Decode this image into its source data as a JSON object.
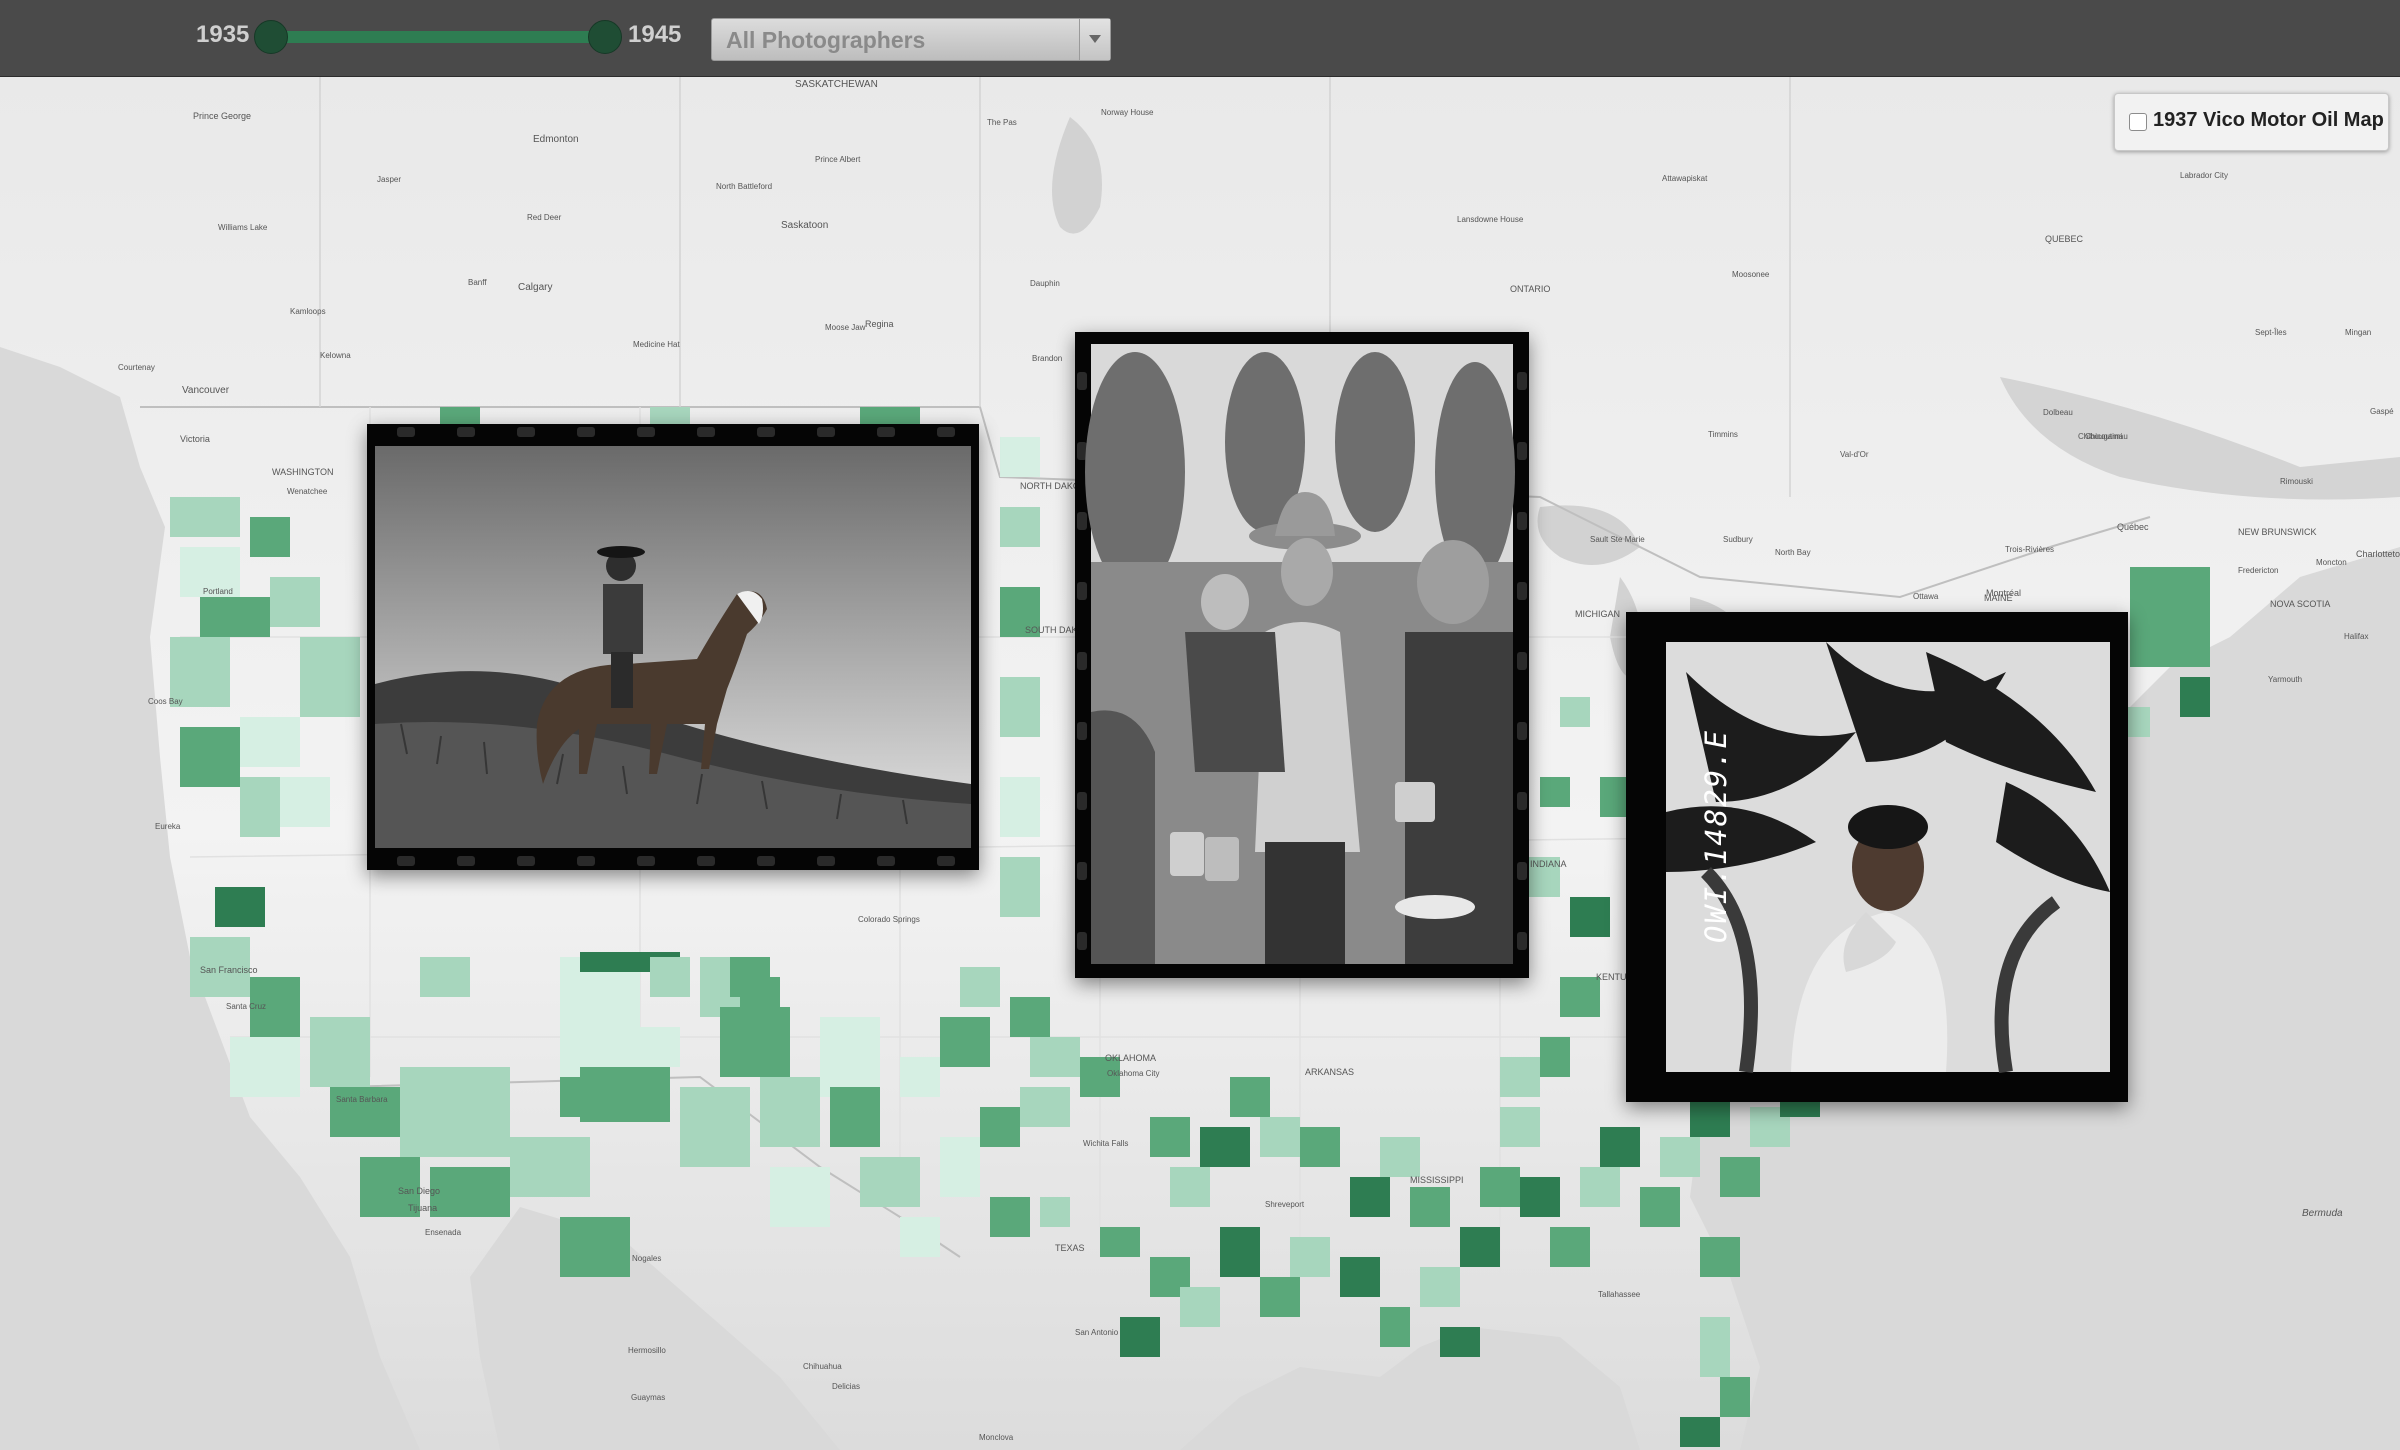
{
  "header": {
    "year_range": {
      "start_label": "1935",
      "end_label": "1945",
      "start_value": 1935,
      "end_value": 1945
    },
    "photographer_filter": {
      "selected": "All Photographers"
    }
  },
  "map_overlay": {
    "label": "1937 Vico Motor Oil Map",
    "checked": false
  },
  "colors": {
    "county_dark": "#2e7d52",
    "county_mid": "#5aa87a",
    "county_light": "#a7d6bd",
    "county_pale": "#d6efe3",
    "slider": "#2e7d52"
  },
  "map": {
    "region_labels": [
      "SASKATCHEWAN",
      "ONTARIO",
      "QUEBEC",
      "NEW BRUNSWICK",
      "NOVA SCOTIA",
      "MAINE",
      "WASHINGTON",
      "NORTH DAKOTA",
      "SOUTH DAKOTA",
      "MICHIGAN",
      "INDIANA",
      "KENTUCKY",
      "OKLAHOMA",
      "ARKANSAS",
      "MISSISSIPPI",
      "TEXAS"
    ],
    "city_labels": [
      "Prince George",
      "Edmonton",
      "Jasper",
      "Williams Lake",
      "Red Deer",
      "Banff",
      "Calgary",
      "Kamloops",
      "Kelowna",
      "Medicine Hat",
      "Vancouver",
      "Victoria",
      "Courtenay",
      "Prince Albert",
      "North Battleford",
      "Saskatoon",
      "The Pas",
      "Norway House",
      "Moose Jaw",
      "Regina",
      "Dauphin",
      "Brandon",
      "Attawapiskat",
      "Lansdowne House",
      "Moosonee",
      "Timmins",
      "Val-d'Or",
      "Chibougamau",
      "Labrador City",
      "Sept-Îles",
      "Mingan",
      "Gaspé",
      "Chicoutimi",
      "Rimouski",
      "Dolbeau",
      "Québec",
      "Trois-Rivières",
      "Montréal",
      "Ottawa",
      "Sudbury",
      "North Bay",
      "Sault Ste Marie",
      "Fredericton",
      "Moncton",
      "Charlottetown",
      "Halifax",
      "Yarmouth",
      "Wenatchee",
      "Portland",
      "Coos Bay",
      "Eureka",
      "San Francisco",
      "Santa Cruz",
      "Santa Barbara",
      "San Diego",
      "Tijuana",
      "Ensenada",
      "Colorado Springs",
      "Oklahoma City",
      "Wichita Falls",
      "Shreveport",
      "San Antonio",
      "Tallahassee",
      "Nogales",
      "Hermosillo",
      "Chihuahua",
      "Guaymas",
      "Delicias",
      "Monclova",
      "Bermuda"
    ]
  },
  "photos": [
    {
      "id": "horseman",
      "subject": "cowboy on horseback on a grassy hill"
    },
    {
      "id": "breadline",
      "subject": "family holding tin cups in a food line"
    },
    {
      "id": "woman",
      "subject": "smiling woman under a palm tree",
      "negative_code": "OWI.14829.E"
    }
  ]
}
